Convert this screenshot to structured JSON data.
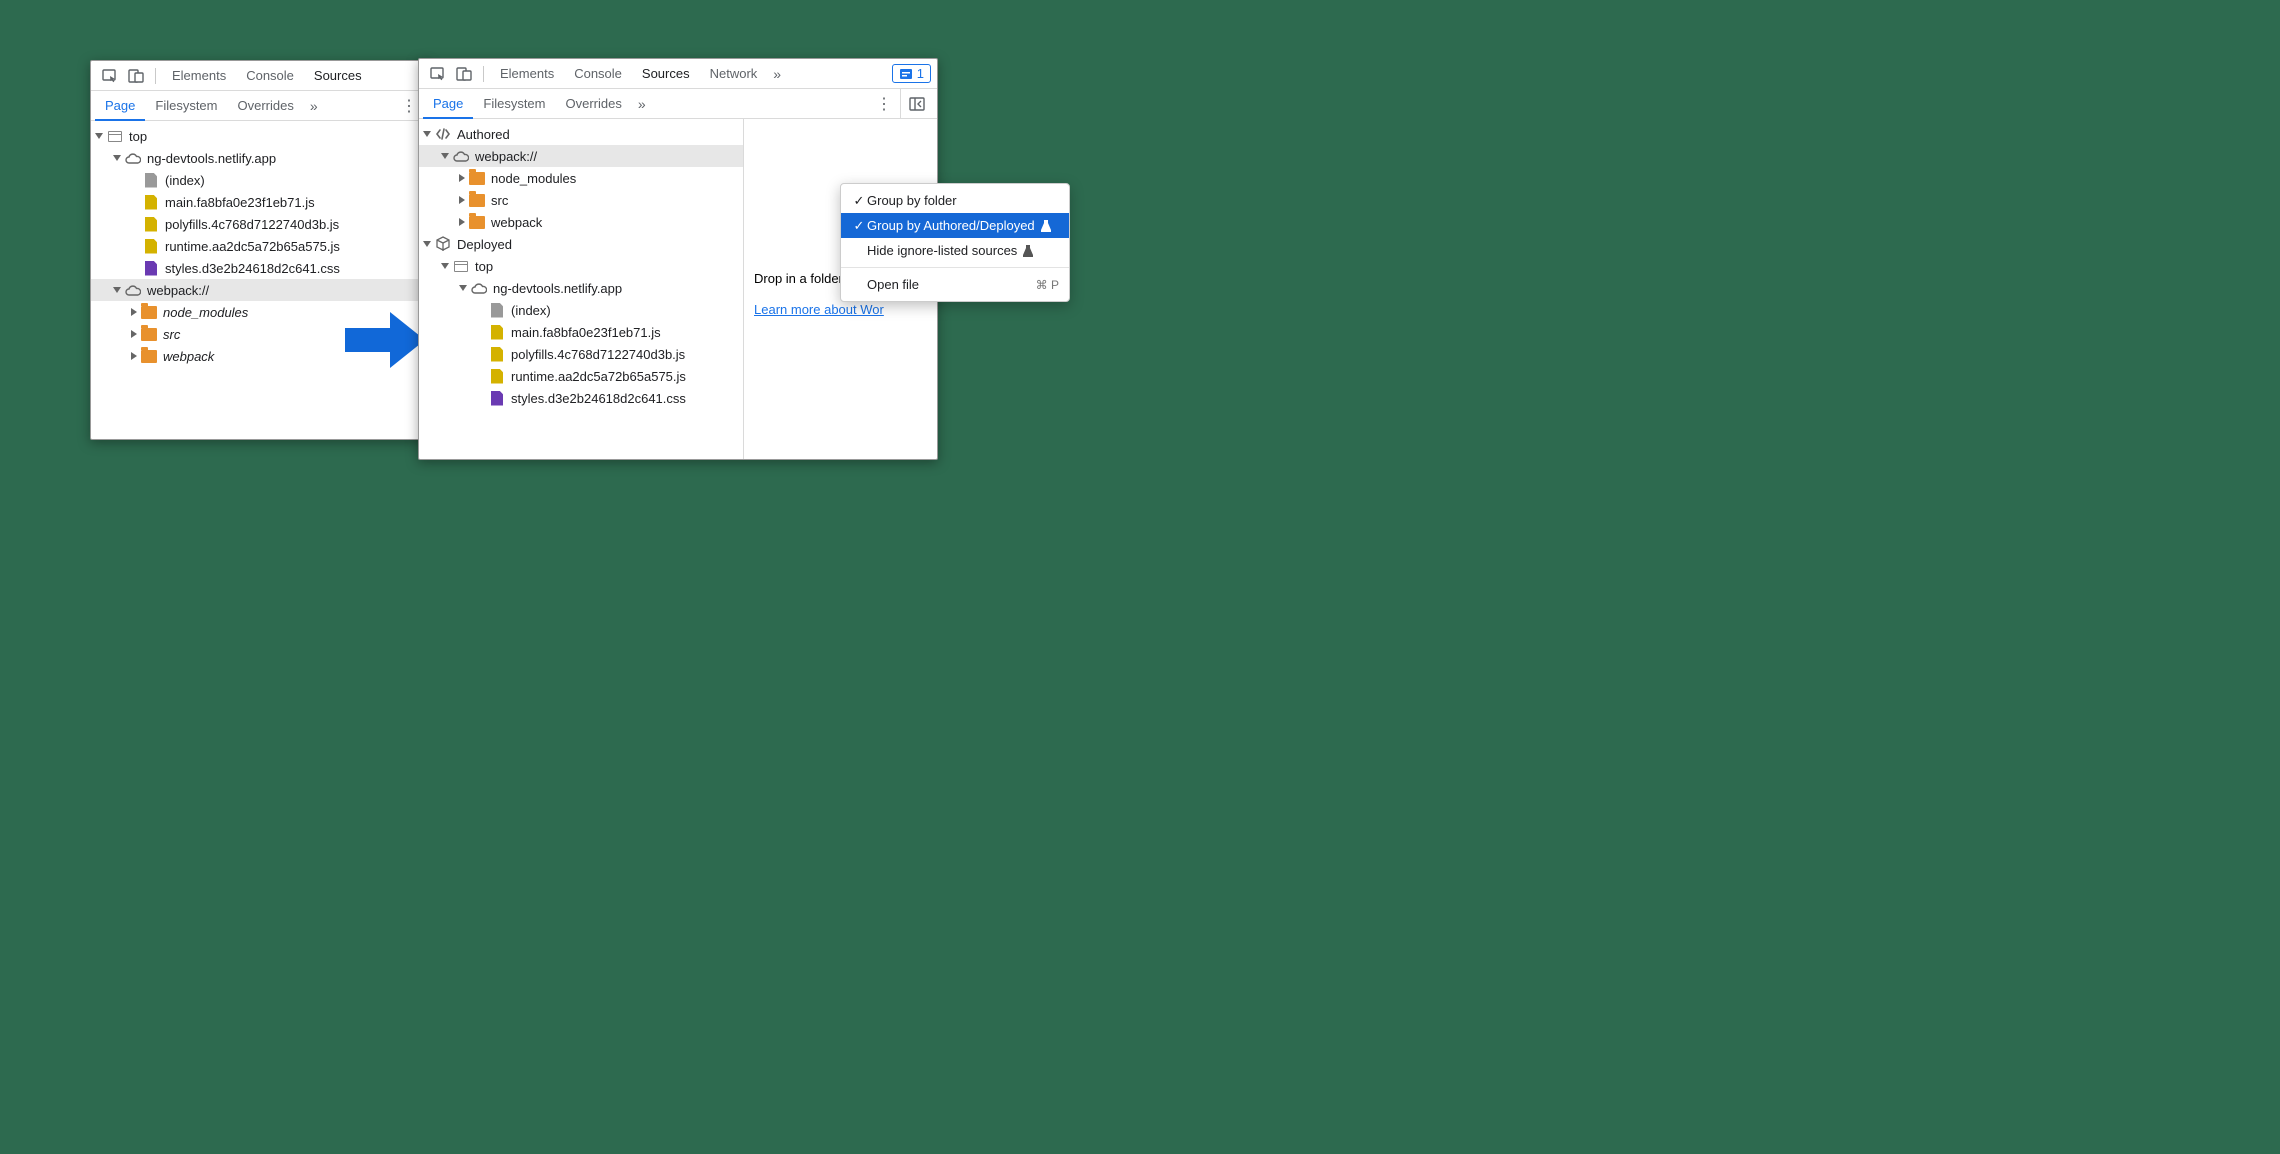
{
  "toolbar": {
    "tabs_left": [
      "Elements",
      "Console",
      "Sources"
    ],
    "tabs_right": [
      "Elements",
      "Console",
      "Sources",
      "Network"
    ],
    "active_tab": "Sources",
    "issues_count": "1"
  },
  "subtabs": {
    "items": [
      "Page",
      "Filesystem",
      "Overrides"
    ],
    "active": "Page"
  },
  "left_tree": {
    "top": "top",
    "domain": "ng-devtools.netlify.app",
    "files": [
      "(index)",
      "main.fa8bfa0e23f1eb71.js",
      "polyfills.4c768d7122740d3b.js",
      "runtime.aa2dc5a72b65a575.js",
      "styles.d3e2b24618d2c641.css"
    ],
    "webpack": "webpack://",
    "webpack_folders": [
      "node_modules",
      "src",
      "webpack"
    ]
  },
  "right_tree": {
    "authored": "Authored",
    "webpack": "webpack://",
    "webpack_folders": [
      "node_modules",
      "src",
      "webpack"
    ],
    "deployed": "Deployed",
    "top": "top",
    "domain": "ng-devtools.netlify.app",
    "files": [
      "(index)",
      "main.fa8bfa0e23f1eb71.js",
      "polyfills.4c768d7122740d3b.js",
      "runtime.aa2dc5a72b65a575.js",
      "styles.d3e2b24618d2c641.css"
    ]
  },
  "menu": {
    "group_folder": "Group by folder",
    "group_authored": "Group by Authored/Deployed",
    "hide_ignore": "Hide ignore-listed sources",
    "open_file": "Open file",
    "open_file_shortcut": "⌘ P"
  },
  "right_pane": {
    "hint": "Drop in a folder to add to",
    "link": "Learn more about Wor"
  }
}
